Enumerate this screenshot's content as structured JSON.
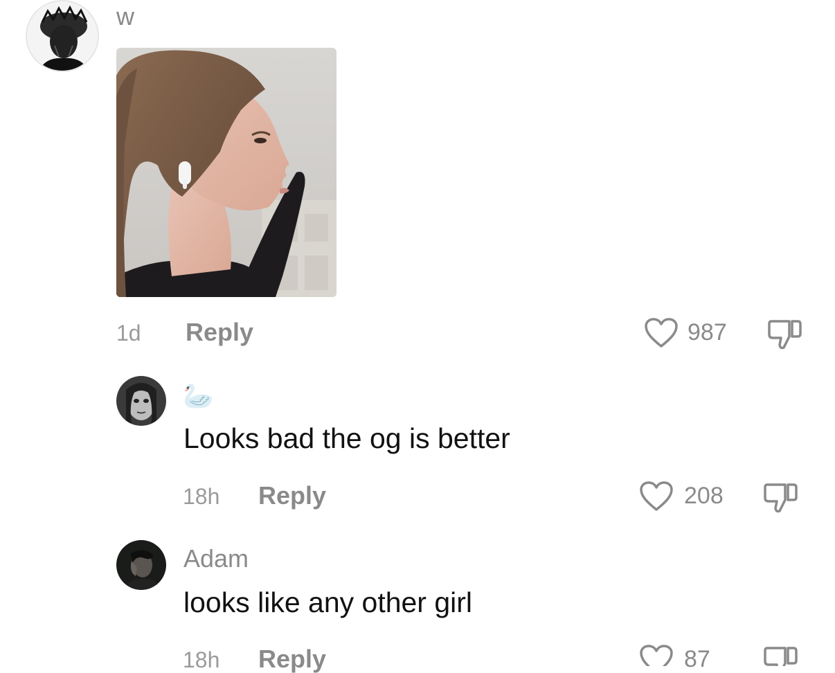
{
  "comments": [
    {
      "username": "w",
      "avatar_icon": "profile-photo",
      "attachment_icon": "photo-attachment",
      "time": "1d",
      "reply_label": "Reply",
      "likes": "987"
    },
    {
      "username": "🦢",
      "avatar_icon": "profile-photo",
      "text": "Looks bad the og is better",
      "time": "18h",
      "reply_label": "Reply",
      "likes": "208"
    },
    {
      "username": "Adam",
      "avatar_icon": "profile-photo",
      "text": "looks like any other girl",
      "time": "18h",
      "reply_label": "Reply",
      "likes": "87"
    }
  ],
  "icons": {
    "like": "heart-icon",
    "dislike": "thumbs-down-icon"
  },
  "colors": {
    "meta_gray": "#8a8a8a",
    "text": "#111111",
    "background": "#ffffff"
  }
}
